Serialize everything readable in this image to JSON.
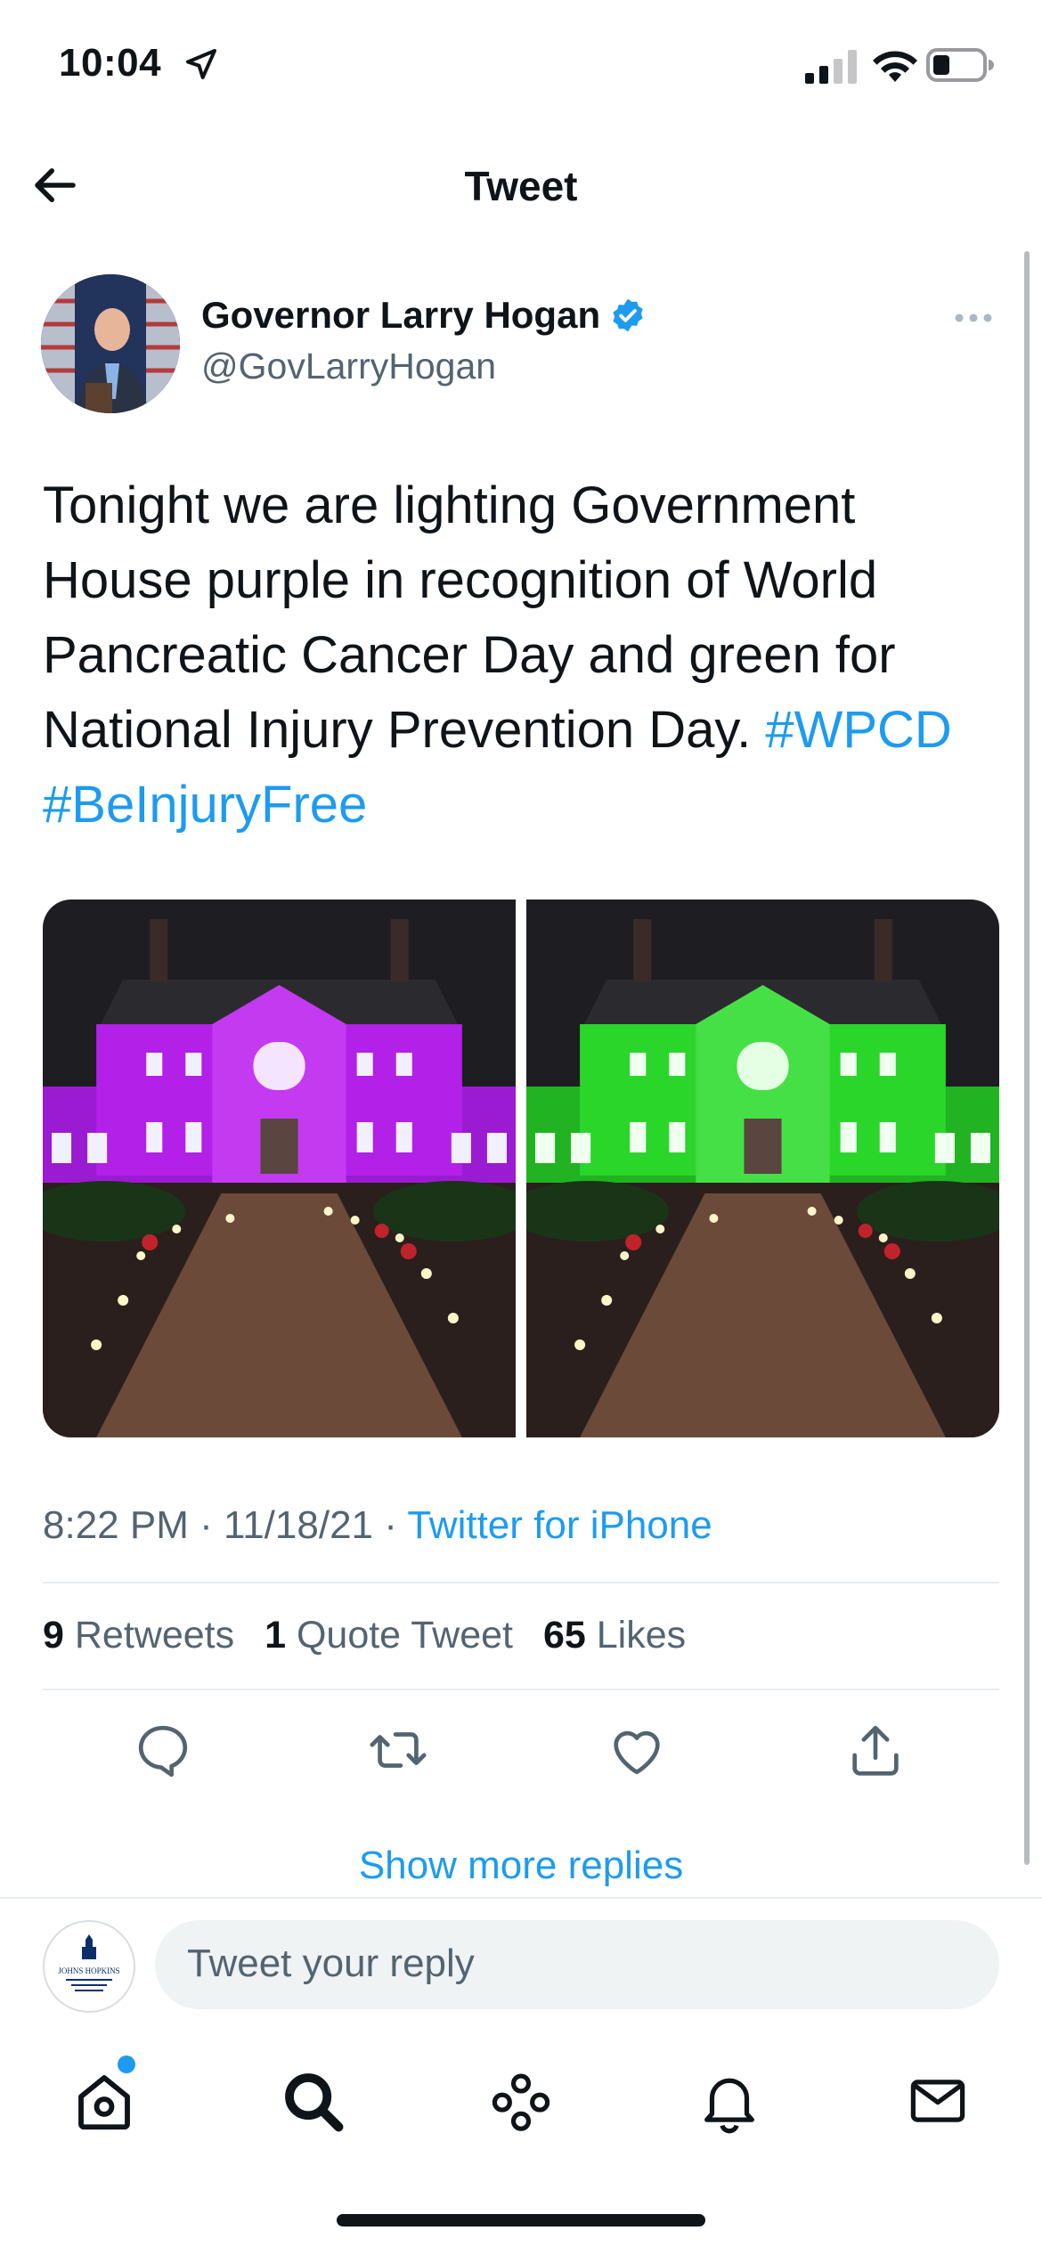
{
  "status_bar": {
    "time": "10:04",
    "location_icon": "location-arrow-icon",
    "signal_icon": "cell-signal-icon",
    "wifi_icon": "wifi-icon",
    "battery_icon": "battery-icon"
  },
  "nav": {
    "title": "Tweet",
    "back_icon": "back-arrow-icon"
  },
  "author": {
    "name": "Governor Larry Hogan",
    "handle": "@GovLarryHogan",
    "verified_color": "#1d9bf0"
  },
  "tweet": {
    "text": "Tonight we are lighting Government House purple in recognition of World Pancreatic Cancer Day and green for National Injury Prevention Day.",
    "hashtags": "#WPCD #BeInjuryFree",
    "time": "8:22 PM",
    "date": "11/18/21",
    "separator": "·",
    "source": "Twitter for iPhone"
  },
  "media": [
    {
      "light_color": "#b320e8"
    },
    {
      "light_color": "#2bd62b"
    }
  ],
  "stats": {
    "retweets_count": "9",
    "retweets_label": "Retweets",
    "quotes_count": "1",
    "quotes_label": "Quote Tweet",
    "likes_count": "65",
    "likes_label": "Likes"
  },
  "actions": [
    "reply-icon",
    "retweet-icon",
    "like-icon",
    "share-icon"
  ],
  "show_more": "Show more replies",
  "reply": {
    "placeholder": "Tweet your reply",
    "avatar_text": "JOHNS HOPKINS"
  },
  "tab_bar": [
    "home-icon",
    "search-icon",
    "spaces-icon",
    "notifications-icon",
    "messages-icon"
  ],
  "colors": {
    "accent": "#1d9bf0",
    "text": "#0f1419",
    "secondary": "#536471"
  }
}
